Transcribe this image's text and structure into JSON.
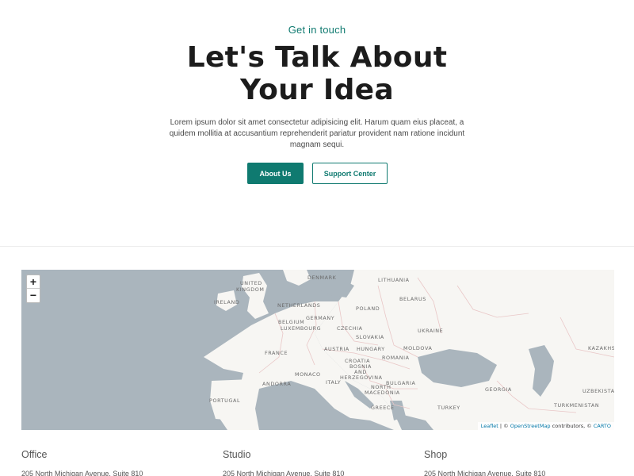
{
  "hero": {
    "eyebrow": "Get in touch",
    "headline_line1": "Let's Talk About",
    "headline_line2_pre": "Your ",
    "headline_highlight": "Idea",
    "lede": "Lorem ipsum dolor sit amet consectetur adipisicing elit. Harum quam eius placeat, a quidem mollitia at accusantium reprehenderit pariatur provident nam ratione incidunt magnam sequi.",
    "primary_button": "About Us",
    "secondary_button": "Support Center"
  },
  "map": {
    "zoom_in": "+",
    "zoom_out": "−",
    "labels": {
      "united_kingdom_1": "UNITED",
      "united_kingdom_2": "KINGDOM",
      "ireland": "IRELAND",
      "denmark": "DENMARK",
      "lithuania": "LITHUANIA",
      "belarus": "BELARUS",
      "netherlands": "NETHERLANDS",
      "poland": "POLAND",
      "belgium": "BELGIUM",
      "germany": "GERMANY",
      "luxembourg": "LUXEMBOURG",
      "czechia": "CZECHIA",
      "ukraine": "UKRAINE",
      "slovakia": "SLOVAKIA",
      "france": "FRANCE",
      "austria": "AUSTRIA",
      "hungary": "HUNGARY",
      "moldova": "MOLDOVA",
      "kazakhstan": "KAZAKHS",
      "croatia": "CROATIA",
      "romania": "ROMANIA",
      "bosnia_1": "BOSNIA",
      "bosnia_2": "AND",
      "bosnia_3": "HERZEGOVINA",
      "monaco": "MONACO",
      "andorra": "ANDORRA",
      "italy": "ITALY",
      "bulgaria": "BULGARIA",
      "north_macedonia_1": "NORTH",
      "north_macedonia_2": "MACEDONIA",
      "georgia": "GEORGIA",
      "uzbekistan": "UZBEKISTA",
      "portugal": "PORTUGAL",
      "greece": "GREECE",
      "turkey": "TURKEY",
      "turkmenistan": "TURKMENISTAN"
    },
    "attribution": {
      "leaflet": "Leaflet",
      "sep1": " | © ",
      "osm": "OpenStreetMap",
      "mid": " contributors, © ",
      "carto": "CARTO"
    },
    "colors": {
      "water": "#aab5bd",
      "land": "#f7f6f3",
      "border": "#e9c7c7"
    }
  },
  "locations": [
    {
      "title": "Office",
      "address": "205 North Michigan Avenue, Suite 810"
    },
    {
      "title": "Studio",
      "address": "205 North Michigan Avenue, Suite 810"
    },
    {
      "title": "Shop",
      "address": "205 North Michigan Avenue, Suite 810"
    }
  ],
  "colors": {
    "accent": "#0f7a70",
    "highlight": "#f6e1c6"
  }
}
